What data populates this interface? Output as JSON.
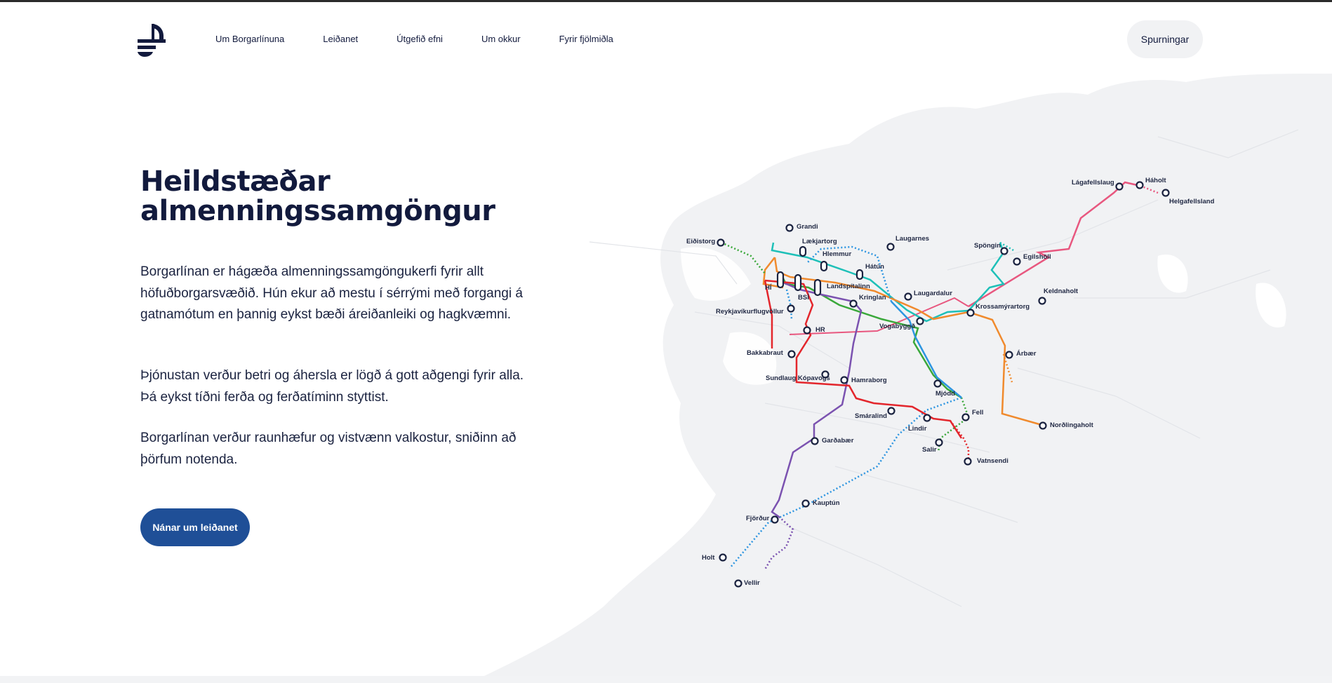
{
  "nav": {
    "items": [
      "Um Borgarlínuna",
      "Leiðanet",
      "Útgefið efni",
      "Um okkur",
      "Fyrir fjölmiðla"
    ],
    "faq_label": "Spurningar"
  },
  "hero": {
    "title_line1": "Heildstæðar",
    "title_line2": "almenningssamgöngur",
    "paragraphs": [
      "Borgarlínan er hágæða almenningssamgöngukerfi fyrir allt höfuðborgarsvæðið. Hún ekur að mestu í sérrými með forgangi á gatnamótum en þannig eykst bæði áreiðanleiki og hagkvæmni.",
      "Þjónustan verður betri og áhersla er lögð á gott aðgengi fyrir alla. Þá eykst tíðni ferða og ferðatíminn styttist.",
      "Borgarlínan verður raunhæfur og vistvænn valkostur, sniðinn að þörfum notenda."
    ],
    "cta_label": "Nánar um leiðanet"
  },
  "map": {
    "stations": {
      "grandi": "Grandi",
      "eidistorg": "Eiðistorg",
      "laekjartorg": "Lækjartorg",
      "hlemmur": "Hlemmur",
      "laugarnes": "Laugarnes",
      "hatun": "Hátún",
      "hi": "HÍ",
      "bsi": "BSÍ",
      "landspitalinn": "Landspítalinn",
      "kringlan": "Kringlan",
      "laugardalur": "Laugardalur",
      "reykjavikurflugvollur": "Reykjavíkurflugvöllur",
      "vogabyggd": "Vogabyggð",
      "hr": "HR",
      "bakkabraut": "Bakkabraut",
      "sundlaug": "Sundlaug Kópavogs",
      "hamraborg": "Hamraborg",
      "mjodd": "Mjódd",
      "smaralind": "Smáralind",
      "lindir": "Lindir",
      "salir": "Salir",
      "fell": "Fell",
      "vatnsendi": "Vatnsendi",
      "gardabaer": "Garðabær",
      "kauptun": "Kauptún",
      "fjordur": "Fjörður",
      "holt": "Holt",
      "vellir": "Vellir",
      "spongin": "Spöngin",
      "egilsholl": "Egilshöll",
      "krossamyrartorg": "Krossamýrartorg",
      "keldnaholt": "Keldnaholt",
      "arbaer": "Árbær",
      "nordlingaholt": "Norðlingaholt",
      "lagafellslaug": "Lágafellslaug",
      "haholt": "Háholt",
      "helgafellsland": "Helgafellsland"
    },
    "line_colors": {
      "red": "#e3262c",
      "purple": "#7b52b0",
      "blue": "#2d95e0",
      "green": "#3aa83a",
      "teal": "#1ec0b8",
      "orange": "#f08a2d",
      "pink": "#e8577f"
    }
  }
}
